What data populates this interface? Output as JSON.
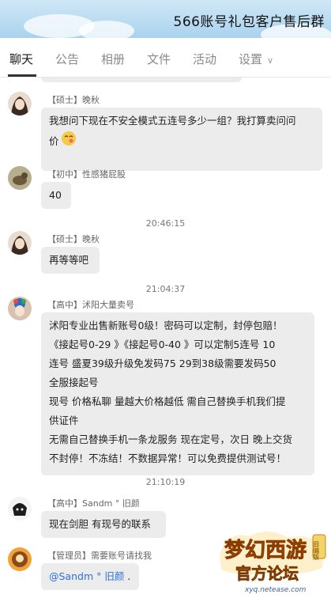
{
  "header": {
    "title": "566账号礼包客户售后群"
  },
  "tabs": [
    {
      "label": "聊天"
    },
    {
      "label": "公告"
    },
    {
      "label": "相册"
    },
    {
      "label": "文件"
    },
    {
      "label": "活动"
    },
    {
      "label": "设置"
    }
  ],
  "messages": [
    {
      "rank": "【硕士】",
      "name": "晚秋",
      "text_lines": [
        "我想问下现在不安全模式五连号多少一组？我打算卖问问",
        "价"
      ]
    },
    {
      "rank": "【初中】",
      "name": "性感猪屁股",
      "text_lines": [
        "40"
      ]
    },
    {
      "rank": "【硕士】",
      "name": "晚秋",
      "text_lines": [
        "再等等吧"
      ]
    },
    {
      "rank": "【高中】",
      "name": "沭阳大量卖号",
      "text_lines": [
        "沭阳专业出售新账号0级！密码可以定制，封停包赔！",
        "《接起号0-29 》《接起号0-40 》可以定制5连号   10",
        "连号    盛夏39级升级免发码75   29到38级需要发码50",
        "全服接起号",
        "现号 价格私聊 量越大价格越低    需自己替换手机我们提",
        "供证件",
        "无需自己替换手机一条龙服务  现在定号，次日 晚上交货",
        "不封停！不冻结！不数据异常！可以免费提供测试号！"
      ]
    },
    {
      "rank": "【高中】",
      "name": "Sandm ° 旧颜",
      "text_lines": [
        "现在剑胆 有现号的联系"
      ]
    },
    {
      "rank": "【管理员】",
      "name": "需要账号请找我",
      "mention": "@Sandm ° 旧颜",
      "tail": " ."
    }
  ],
  "timestamps": [
    "20:46:15",
    "21:04:37",
    "21:10:19"
  ],
  "watermark": {
    "logo_text": "梦幻西游",
    "badge": "旧编版",
    "subtitle": "官方论坛",
    "url": "xyq.netease.com"
  }
}
